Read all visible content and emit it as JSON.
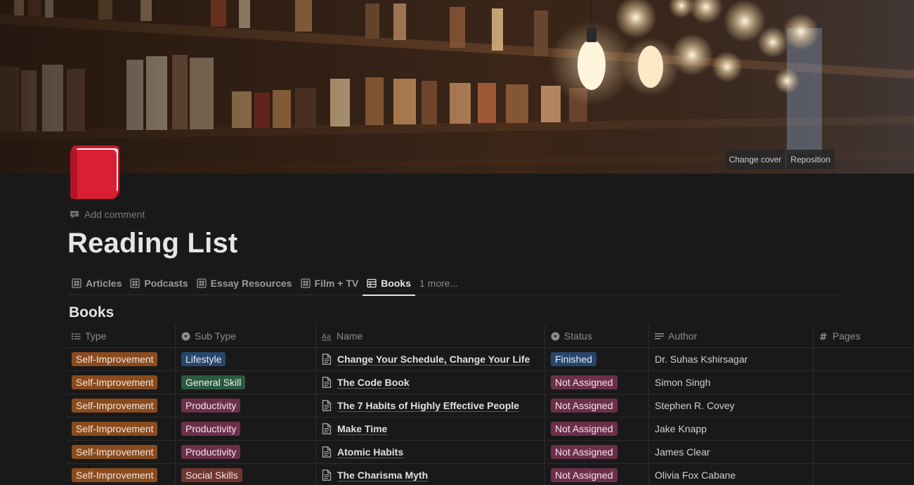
{
  "cover": {
    "change_cover_label": "Change cover",
    "reposition_label": "Reposition"
  },
  "page": {
    "icon": "red-book-icon",
    "add_comment_label": "Add comment",
    "title": "Reading List"
  },
  "tabs": [
    {
      "label": "Articles",
      "icon": "gallery-icon"
    },
    {
      "label": "Podcasts",
      "icon": "gallery-icon"
    },
    {
      "label": "Essay Resources",
      "icon": "gallery-icon"
    },
    {
      "label": "Film + TV",
      "icon": "gallery-icon"
    },
    {
      "label": "Books",
      "icon": "table-icon",
      "active": true
    },
    {
      "label": "1 more..."
    }
  ],
  "section_title": "Books",
  "table": {
    "columns": [
      {
        "label": "Type",
        "icon": "list-icon"
      },
      {
        "label": "Sub Type",
        "icon": "select-icon"
      },
      {
        "label": "Name",
        "icon": "title-icon"
      },
      {
        "label": "Status",
        "icon": "select-icon"
      },
      {
        "label": "Author",
        "icon": "text-icon"
      },
      {
        "label": "Pages",
        "icon": "number-icon"
      }
    ],
    "rows": [
      {
        "type": "Self-Improvement",
        "subtype": "Lifestyle",
        "subtype_color": "blue",
        "name": "Change Your Schedule, Change Your Life",
        "status": "Finished",
        "status_color": "blue",
        "author": "Dr. Suhas Kshirsagar",
        "pages": ""
      },
      {
        "type": "Self-Improvement",
        "subtype": "General Skill",
        "subtype_color": "green",
        "name": "The Code Book",
        "status": "Not Assigned",
        "status_color": "purple",
        "author": "Simon Singh",
        "pages": ""
      },
      {
        "type": "Self-Improvement",
        "subtype": "Productivity",
        "subtype_color": "purple",
        "name": "The 7 Habits of Highly Effective People",
        "status": "Not Assigned",
        "status_color": "purple",
        "author": "Stephen R. Covey",
        "pages": ""
      },
      {
        "type": "Self-Improvement",
        "subtype": "Productivity",
        "subtype_color": "purple",
        "name": "Make Time",
        "status": "Not Assigned",
        "status_color": "purple",
        "author": "Jake Knapp",
        "pages": ""
      },
      {
        "type": "Self-Improvement",
        "subtype": "Productivity",
        "subtype_color": "purple",
        "name": "Atomic Habits",
        "status": "Not Assigned",
        "status_color": "purple",
        "author": "James Clear",
        "pages": ""
      },
      {
        "type": "Self-Improvement",
        "subtype": "Social Skills",
        "subtype_color": "red",
        "name": "The Charisma Myth",
        "status": "Not Assigned",
        "status_color": "purple",
        "author": "Olivia Fox Cabane",
        "pages": ""
      }
    ]
  }
}
